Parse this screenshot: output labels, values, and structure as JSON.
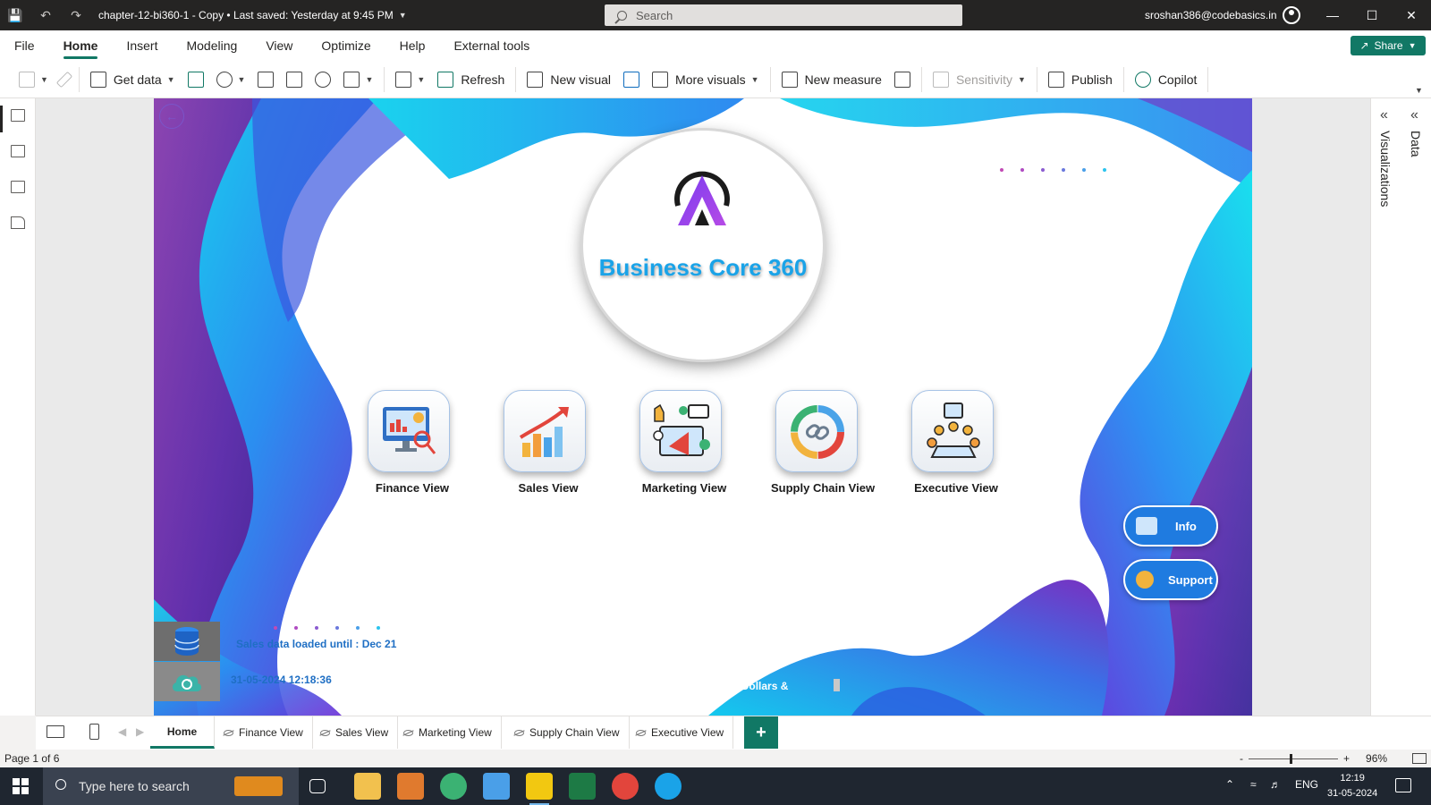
{
  "titlebar": {
    "title": "chapter-12-bi360-1 - Copy • Last saved: Yesterday at 9:45 PM",
    "search_placeholder": "Search",
    "user": "sroshan386@codebasics.in"
  },
  "ribbon": {
    "tabs": [
      "File",
      "Home",
      "Insert",
      "Modeling",
      "View",
      "Optimize",
      "Help",
      "External tools"
    ],
    "active_tab": "Home",
    "share_label": "Share",
    "buttons": {
      "get_data": "Get data",
      "refresh": "Refresh",
      "new_visual": "New visual",
      "more_visuals": "More visuals",
      "new_measure": "New measure",
      "sensitivity": "Sensitivity",
      "publish": "Publish",
      "copilot": "Copilot"
    }
  },
  "report": {
    "logo_text": "Business Core 360",
    "views": [
      {
        "label": "Finance View",
        "icon": "finance-monitor-icon"
      },
      {
        "label": "Sales View",
        "icon": "sales-growth-icon"
      },
      {
        "label": "Marketing View",
        "icon": "marketing-megaphone-icon"
      },
      {
        "label": "Supply Chain View",
        "icon": "supply-chain-link-icon"
      },
      {
        "label": "Executive View",
        "icon": "executive-meeting-icon"
      }
    ],
    "info_label": "Info",
    "support_label": "Support",
    "sales_loaded": "Sales data loaded until : Dec 21",
    "refresh_time": "31-05-2024 12:18:36",
    "values_note": "Values are in Dollars &"
  },
  "panes": {
    "visualizations": "Visualizations",
    "data": "Data"
  },
  "page_tabs": [
    "Home",
    "Finance View",
    "Sales View",
    "Marketing View",
    "Supply Chain View",
    "Executive View"
  ],
  "status": {
    "page": "Page 1 of 6",
    "zoom": "96%"
  },
  "taskbar": {
    "search_placeholder": "Type here to search",
    "lang": "ENG",
    "time": "12:19",
    "date": "31-05-2024"
  },
  "colors": {
    "accent": "#117865",
    "brand_blue": "#1aa3e8",
    "purple": "#7a2fc0",
    "cyan": "#16d8ee"
  }
}
